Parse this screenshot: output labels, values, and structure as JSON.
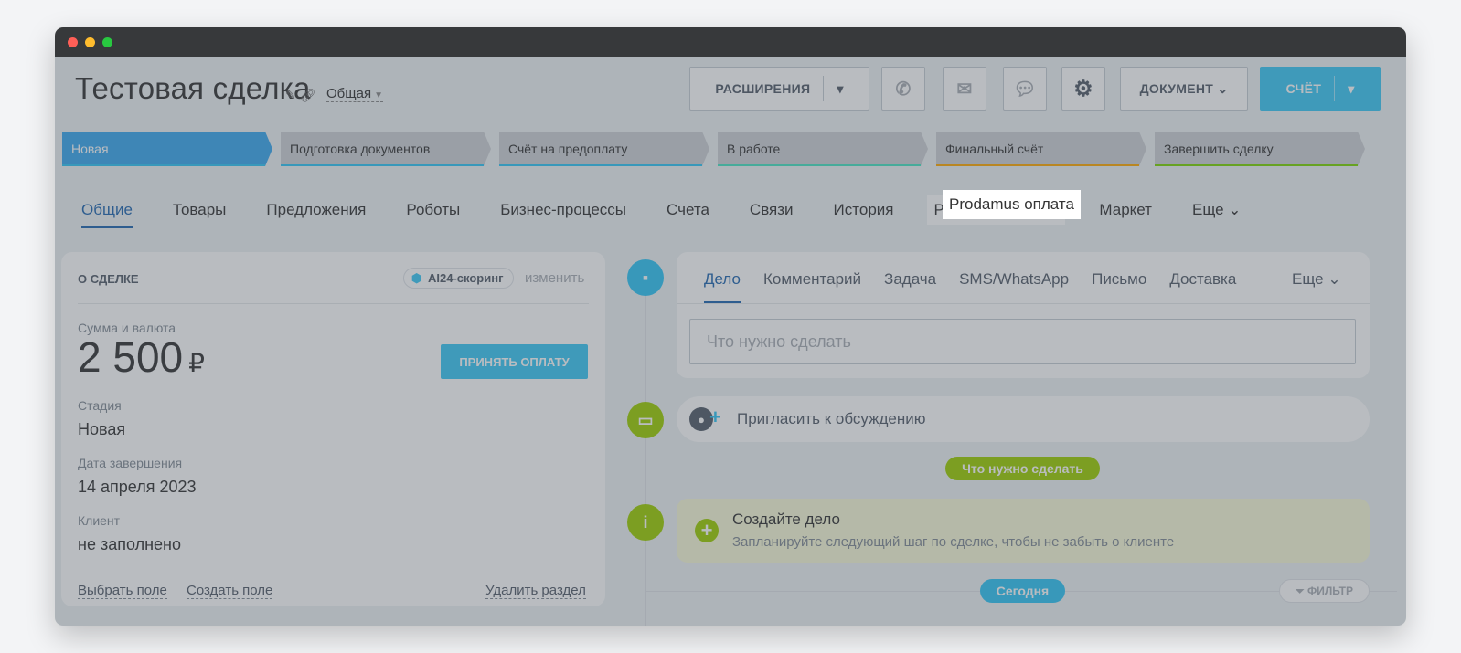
{
  "deal": {
    "title": "Тестовая сделка",
    "category": "Общая"
  },
  "toolbar": {
    "extensions": "РАСШИРЕНИЯ",
    "document": "ДОКУМЕНТ",
    "invoice": "СЧЁТ"
  },
  "stages": [
    {
      "label": "Новая",
      "color": "#2fc6f6",
      "active": true
    },
    {
      "label": "Подготовка документов",
      "color": "#2fc6f6"
    },
    {
      "label": "Счёт на предоплату",
      "color": "#2fc6f6"
    },
    {
      "label": "В работе",
      "color": "#47e4c2"
    },
    {
      "label": "Финальный счёт",
      "color": "#ffa900"
    },
    {
      "label": "Завершить сделку",
      "color": "#7bd500"
    }
  ],
  "tabs": [
    "Общие",
    "Товары",
    "Предложения",
    "Роботы",
    "Бизнес-процессы",
    "Счета",
    "Связи",
    "История",
    "Prodamus оплата",
    "Маркет",
    "Еще"
  ],
  "about": {
    "header": "О СДЕЛКЕ",
    "ai_scoring": "AI24-скоринг",
    "change": "изменить",
    "amount_label": "Сумма и валюта",
    "amount": "2 500",
    "currency": "₽",
    "pay_button": "ПРИНЯТЬ ОПЛАТУ",
    "stage_label": "Стадия",
    "stage_value": "Новая",
    "close_date_label": "Дата завершения",
    "close_date_value": "14 апреля 2023",
    "client_label": "Клиент",
    "client_value": "не заполнено",
    "select_field": "Выбрать поле",
    "create_field": "Создать поле",
    "delete_section": "Удалить раздел"
  },
  "activity": {
    "tabs": [
      "Дело",
      "Комментарий",
      "Задача",
      "SMS/WhatsApp",
      "Письмо",
      "Доставка"
    ],
    "more": "Еще",
    "placeholder": "Что нужно сделать"
  },
  "timeline": {
    "invite": "Пригласить к обсуждению",
    "todo_pill": "Что нужно сделать",
    "create_title": "Создайте дело",
    "create_sub": "Запланируйте следующий шаг по сделке, чтобы не забыть о клиенте",
    "today": "Сегодня",
    "filter": "ФИЛЬТР"
  }
}
